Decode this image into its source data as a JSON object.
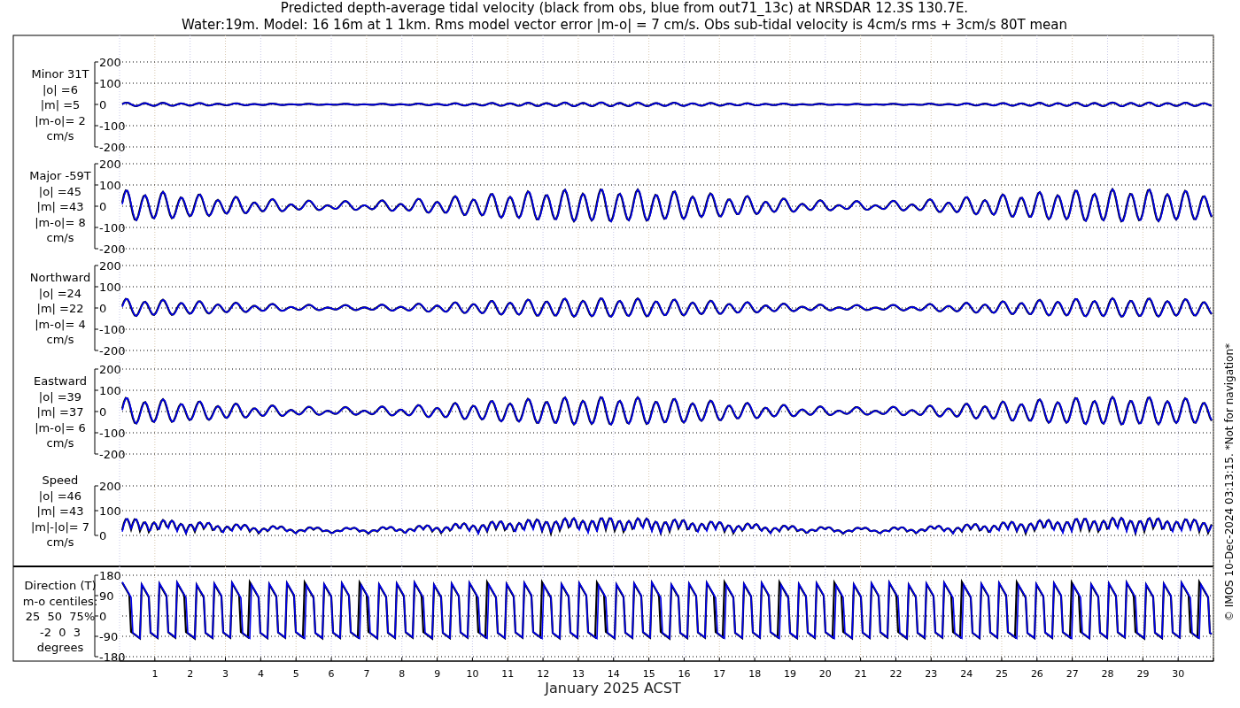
{
  "title_lines": [
    "Predicted depth-average tidal velocity (black from obs, blue from out71_13c) at NRSDAR 12.3S 130.7E.",
    "Water:19m. Model: 16 16m at 1 1km. Rms model vector error |m-o| = 7 cm/s. Obs sub-tidal velocity is 4cm/s rms + 3cm/s 80T mean"
  ],
  "panels": [
    {
      "kind": "velocity",
      "label_lines": [
        "Minor 31T",
        "|o| =6",
        "|m| =5",
        "|m-o|= 2",
        "cm/s"
      ],
      "yticks": [
        "200",
        "100",
        "0",
        "-100",
        "-200"
      ]
    },
    {
      "kind": "velocity",
      "label_lines": [
        "Major -59T",
        "|o| =45",
        "|m| =43",
        "|m-o|= 8",
        "cm/s"
      ],
      "yticks": [
        "200",
        "100",
        "0",
        "-100",
        "-200"
      ]
    },
    {
      "kind": "velocity",
      "label_lines": [
        "Northward",
        "|o| =24",
        "|m| =22",
        "|m-o|= 4",
        "cm/s"
      ],
      "yticks": [
        "200",
        "100",
        "0",
        "-100",
        "-200"
      ]
    },
    {
      "kind": "velocity",
      "label_lines": [
        "Eastward",
        "|o| =39",
        "|m| =37",
        "|m-o|= 6",
        "cm/s"
      ],
      "yticks": [
        "200",
        "100",
        "0",
        "-100",
        "-200"
      ]
    },
    {
      "kind": "speed",
      "label_lines": [
        "Speed",
        "|o| =46",
        "|m| =43",
        "|m|-|o|= 7",
        "cm/s"
      ],
      "yticks": [
        "200",
        "100",
        "0"
      ]
    },
    {
      "kind": "direction",
      "label_lines": [
        "Direction (T)",
        "m-o centiles:",
        "25  50  75%",
        "-2  0  3",
        "degrees"
      ],
      "yticks": [
        "180",
        "90",
        "0",
        "-90",
        "-180"
      ]
    }
  ],
  "x_ticks": [
    "1",
    "2",
    "3",
    "4",
    "5",
    "6",
    "7",
    "8",
    "9",
    "10",
    "11",
    "12",
    "13",
    "14",
    "15",
    "16",
    "17",
    "18",
    "19",
    "20",
    "21",
    "22",
    "23",
    "24",
    "25",
    "26",
    "27",
    "28",
    "29",
    "30"
  ],
  "xlabel": "January 2025 ACST",
  "footer": "© IMOS 10-Dec-2024 03:13:15. *Not for navigation*"
}
